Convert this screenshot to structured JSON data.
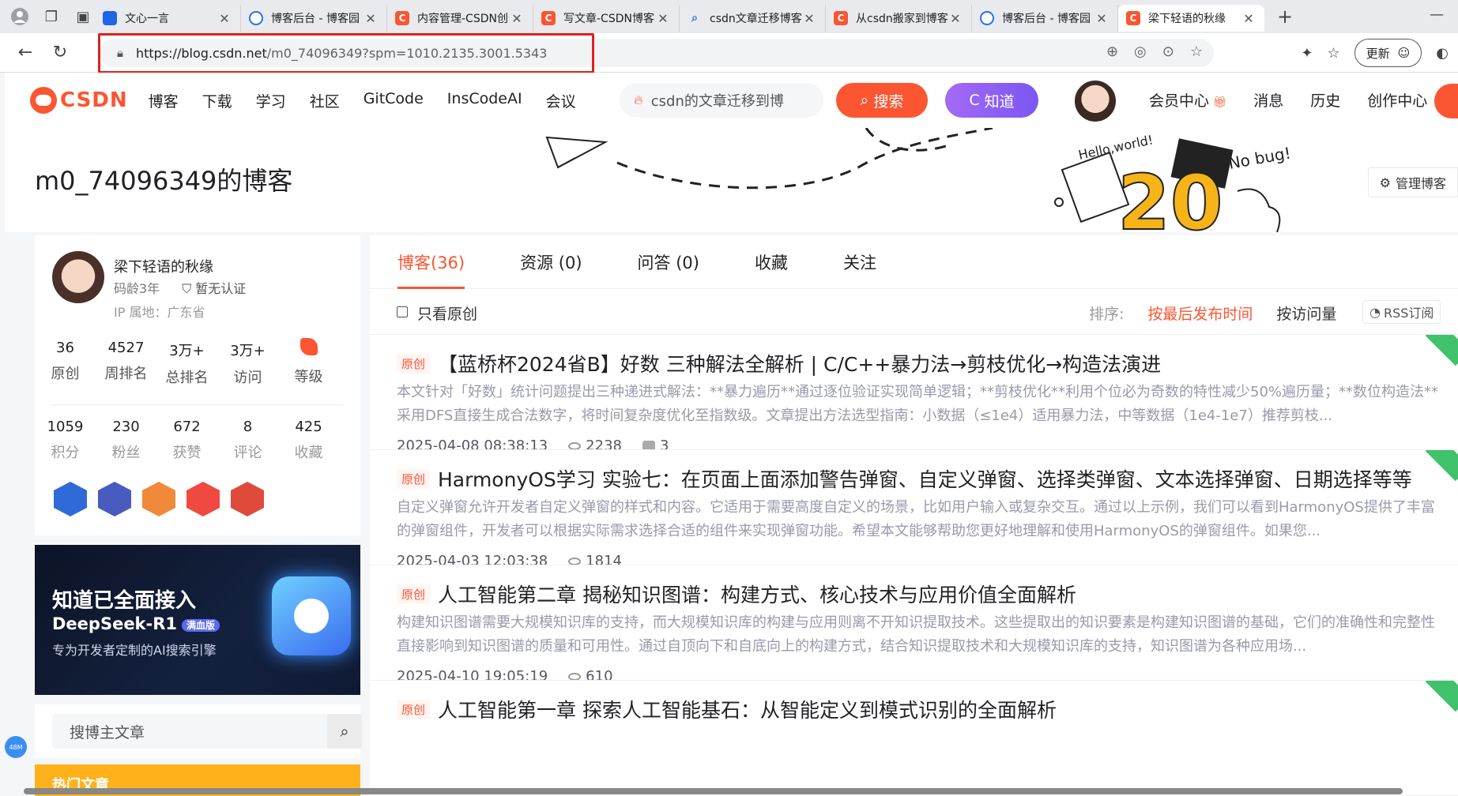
{
  "browser": {
    "tabs": [
      {
        "title": "文心一言",
        "fav": "w"
      },
      {
        "title": "博客后台 - 博客园",
        "fav": "b"
      },
      {
        "title": "内容管理-CSDN创作中心",
        "fav": "c"
      },
      {
        "title": "写文章-CSDN博客",
        "fav": "c"
      },
      {
        "title": "csdn文章迁移博客园",
        "fav": "s"
      },
      {
        "title": "从csdn搬家到博客园",
        "fav": "c"
      },
      {
        "title": "博客后台 - 博客园",
        "fav": "b"
      },
      {
        "title": "梁下轻语的秋缘",
        "fav": "c",
        "active": true
      }
    ],
    "url_host": "https://blog.csdn.net",
    "url_path": "/m0_74096349?spm=1010.2135.3001.5343",
    "update_label": "更新"
  },
  "header": {
    "logo": "CSDN",
    "nav": [
      "博客",
      "下载",
      "学习",
      "社区",
      "GitCode",
      "InsCodeAI",
      "会议"
    ],
    "search_placeholder": "csdn的文章迁移到博",
    "search_button": "搜索",
    "zhidao_button": "知道",
    "links": [
      "会员中心",
      "消息",
      "历史",
      "创作中心"
    ]
  },
  "banner": {
    "blog_title": "m0_74096349的博客",
    "manage_label": "管理博客",
    "art_text_1": "Hello,world!",
    "art_text_2": "No bug!",
    "art_text_3": "20"
  },
  "profile": {
    "name": "梁下轻语的秋缘",
    "code_age": "码龄3年",
    "cert": "暂无认证",
    "ip": "IP 属地：广东省",
    "stats1": [
      {
        "num": "36",
        "label": "原创"
      },
      {
        "num": "4527",
        "label": "周排名"
      },
      {
        "num": "3万+",
        "label": "总排名"
      },
      {
        "num": "3万+",
        "label": "访问"
      },
      {
        "num": "",
        "label": "等级"
      }
    ],
    "stats2": [
      {
        "num": "1059",
        "label": "积分"
      },
      {
        "num": "230",
        "label": "粉丝"
      },
      {
        "num": "672",
        "label": "获赞"
      },
      {
        "num": "8",
        "label": "评论"
      },
      {
        "num": "425",
        "label": "收藏"
      }
    ],
    "badges": [
      "#2f6bd8",
      "#4a5bbf",
      "#f08a3a",
      "#f0493f",
      "#e04a3a"
    ]
  },
  "ad": {
    "line1": "知道已全面接入",
    "line2": "DeepSeek-R1",
    "line2_tag": "满血版",
    "line3": "专为开发者定制的AI搜索引擎"
  },
  "sidebar": {
    "search_placeholder": "搜博主文章",
    "hot_label": "热门文章",
    "mem_label": "48M"
  },
  "main": {
    "tabs": [
      "博客(36)",
      "资源 (0)",
      "问答 (0)",
      "收藏",
      "关注"
    ],
    "only_original": "只看原创",
    "sort_label": "排序:",
    "sort_options": [
      "按最后发布时间",
      "按访问量"
    ],
    "rss": "RSS订阅",
    "articles": [
      {
        "tag": "原创",
        "title": "【蓝桥杯2024省B】好数 三种解法全解析 | C/C++暴力法→剪枝优化→构造法演进",
        "desc": "本文针对「好数」统计问题提出三种递进式解法：**暴力遍历**通过逐位验证实现简单逻辑；**剪枝优化**利用个位必为奇数的特性减少50%遍历量；**数位构造法**采用DFS直接生成合法数字，将时间复杂度优化至指数级。文章提出方法选型指南：小数据（≤1e4）适用暴力法，中等数据（1e4-1e7）推荐剪枝...",
        "date": "2025-04-08 08:38:13",
        "views": "2238",
        "comments": "3"
      },
      {
        "tag": "原创",
        "title": "HarmonyOS学习 实验七：在页面上面添加警告弹窗、自定义弹窗、选择类弹窗、文本选择弹窗、日期选择等等",
        "desc": "自定义弹窗允许开发者自定义弹窗的样式和内容。它适用于需要高度自定义的场景，比如用户输入或复杂交互。通过以上示例，我们可以看到HarmonyOS提供了丰富的弹窗组件，开发者可以根据实际需求选择合适的组件来实现弹窗功能。希望本文能够帮助您更好地理解和使用HarmonyOS的弹窗组件。如果您...",
        "date": "2025-04-03 12:03:38",
        "views": "1814",
        "comments": ""
      },
      {
        "tag": "原创",
        "title": "人工智能第二章 揭秘知识图谱：构建方式、核心技术与应用价值全面解析",
        "desc": "构建知识图谱需要大规模知识库的支持，而大规模知识库的构建与应用则离不开知识提取技术。这些提取出的知识要素是构建知识图谱的基础，它们的准确性和完整性直接影响到知识图谱的质量和可用性。通过自顶向下和自底向上的构建方式，结合知识提取技术和大规模知识库的支持，知识图谱为各种应用场...",
        "date": "2025-04-10 19:05:19",
        "views": "610",
        "comments": ""
      },
      {
        "tag": "原创",
        "title": "人工智能第一章 探索人工智能基石：从智能定义到模式识别的全面解析",
        "desc": "",
        "date": "",
        "views": "",
        "comments": ""
      }
    ]
  },
  "colors": {
    "brand": "#fc5531",
    "zhidao": "#8a5ff4",
    "hot": "#ffb11b",
    "highlight": "#e02020"
  }
}
